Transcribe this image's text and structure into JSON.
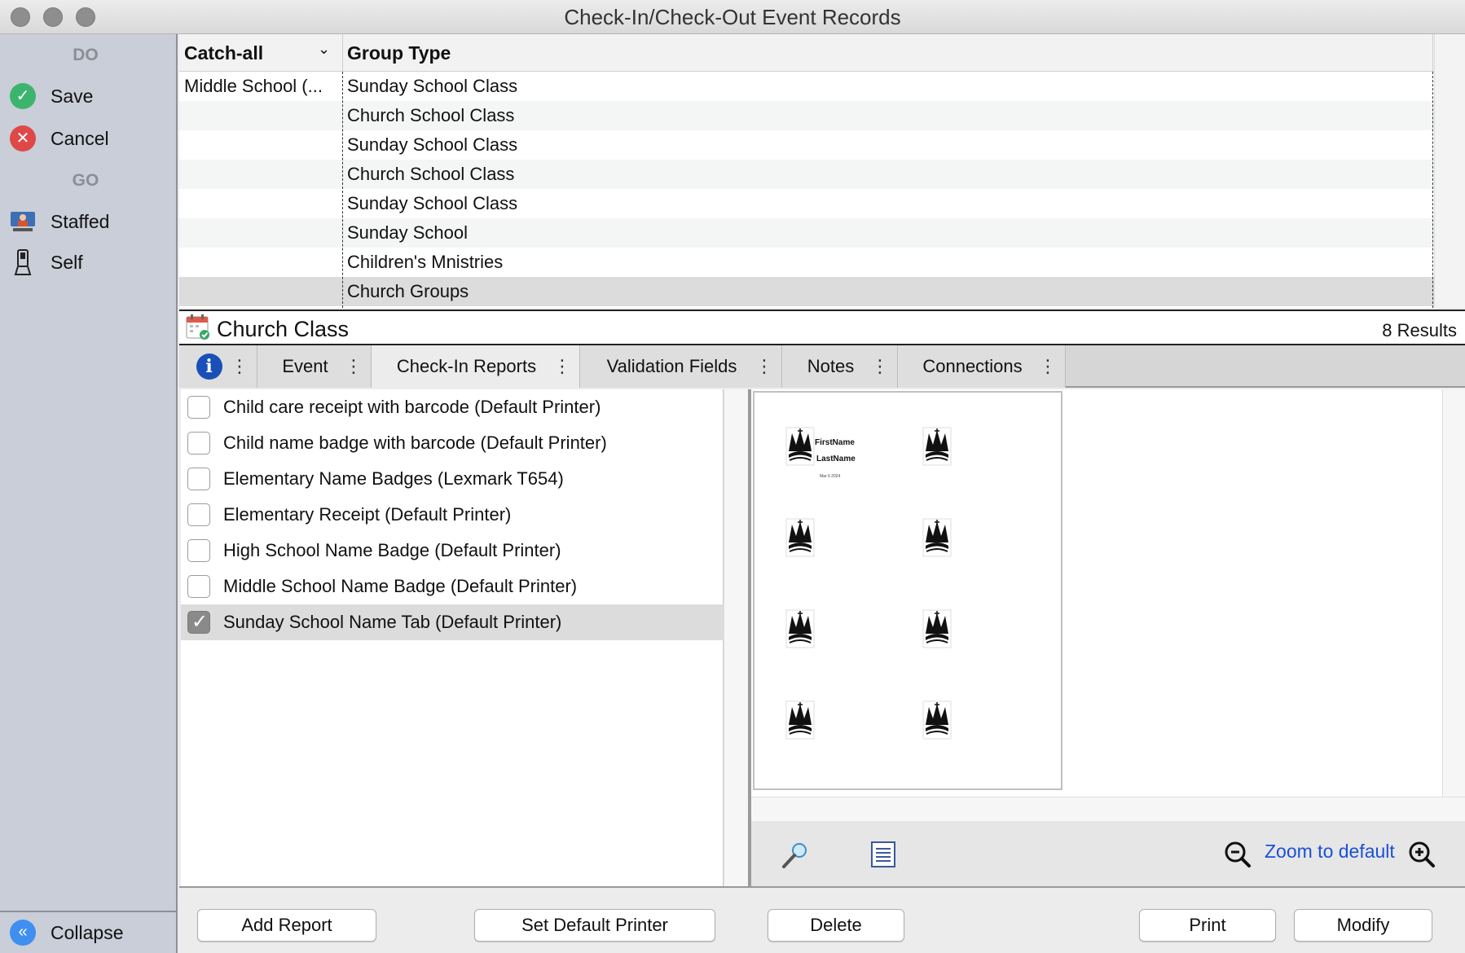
{
  "window": {
    "title": "Check-In/Check-Out Event Records"
  },
  "sidebar": {
    "do_heading": "DO",
    "go_heading": "GO",
    "items": [
      {
        "label": "Save",
        "icon": "check-icon",
        "color": "#3cb46e"
      },
      {
        "label": "Cancel",
        "icon": "x-icon",
        "color": "#e04848"
      },
      {
        "label": "Staffed",
        "icon": "staffed-monitor-icon"
      },
      {
        "label": "Self",
        "icon": "kiosk-icon"
      }
    ],
    "collapse_label": "Collapse"
  },
  "grid": {
    "columns": [
      "Catch-all",
      "Group Type"
    ],
    "rows": [
      {
        "catch_all": "Middle School (...",
        "group_type": "Sunday School Class"
      },
      {
        "catch_all": "",
        "group_type": "Church School Class"
      },
      {
        "catch_all": "",
        "group_type": "Sunday School Class"
      },
      {
        "catch_all": "",
        "group_type": "Church School Class"
      },
      {
        "catch_all": "",
        "group_type": "Sunday School Class"
      },
      {
        "catch_all": "",
        "group_type": "Sunday School"
      },
      {
        "catch_all": "",
        "group_type": "Children's Mnistries"
      },
      {
        "catch_all": "",
        "group_type": "Church Groups"
      }
    ]
  },
  "section": {
    "title": "Church Class",
    "results": "8 Results"
  },
  "tabs": [
    "Event",
    "Check-In Reports",
    "Validation Fields",
    "Notes",
    "Connections"
  ],
  "reports": [
    {
      "label": "Child care receipt with barcode (Default Printer)",
      "checked": false
    },
    {
      "label": "Child name badge with barcode (Default Printer)",
      "checked": false
    },
    {
      "label": "Elementary Name Badges (Lexmark T654)",
      "checked": false
    },
    {
      "label": "Elementary Receipt (Default Printer)",
      "checked": false
    },
    {
      "label": "High School Name Badge (Default Printer)",
      "checked": false
    },
    {
      "label": "Middle School Name Badge (Default Printer)",
      "checked": false
    },
    {
      "label": "Sunday School Name Tab (Default Printer)",
      "checked": true
    }
  ],
  "preview": {
    "first_name": "FirstName",
    "last_name": "LastName",
    "date": "Mar 6 2024",
    "zoom_label": "Zoom to default"
  },
  "buttons": {
    "add_report": "Add Report",
    "set_default_printer": "Set Default Printer",
    "delete": "Delete",
    "print": "Print",
    "modify": "Modify"
  },
  "colors": {
    "accent": "#1a50d8",
    "info": "#1a4fb8"
  }
}
